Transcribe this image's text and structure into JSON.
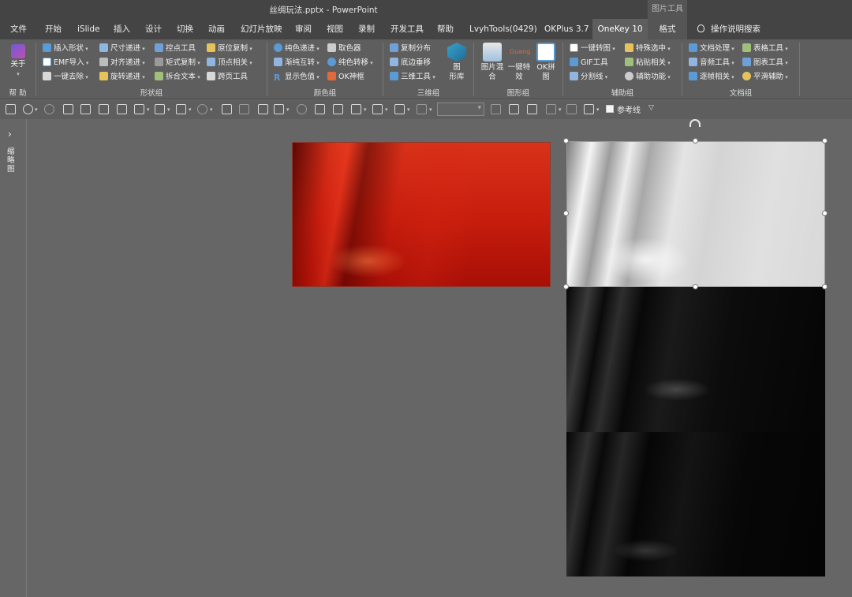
{
  "window": {
    "title": "丝绸玩法.pptx  -  PowerPoint",
    "context_tab_group": "图片工具"
  },
  "menu": {
    "tabs": [
      "文件",
      "开始",
      "iSlide",
      "插入",
      "设计",
      "切换",
      "动画",
      "幻灯片放映",
      "审阅",
      "视图",
      "录制",
      "开发工具",
      "帮助",
      "LvyhTools(0429)",
      "OKPlus 3.7",
      "OneKey 10",
      "格式"
    ],
    "active_tab": "OneKey 10",
    "tell_me": "操作说明搜索"
  },
  "ribbon": {
    "help_group": {
      "button": "关于",
      "label": "帮 助"
    },
    "shape_group": {
      "label": "形状组",
      "items": [
        "插入形状",
        "尺寸递进",
        "控点工具",
        "原位复制",
        "EMF导入",
        "对齐递进",
        "矩式复制",
        "顶点相关",
        "一键去除",
        "旋转递进",
        "拆合文本",
        "跨页工具"
      ]
    },
    "color_group": {
      "label": "颜色组",
      "items": [
        "纯色递进",
        "取色器",
        "渐纯互转",
        "纯色转移",
        "显示色值",
        "OK神框"
      ]
    },
    "three_d_group": {
      "label": "三维组",
      "items": [
        "复制分布",
        "底边垂移",
        "三维工具"
      ],
      "big_button": "图\n形库"
    },
    "graphic_group": {
      "label": "图形组",
      "big_buttons": [
        "图片混\n合",
        "一键特\n效",
        "OK拼\n图"
      ],
      "effect_logo_text": "Guang"
    },
    "assist_group": {
      "label": "辅助组",
      "items": [
        "一键转图",
        "特殊选中",
        "GIF工具",
        "粘贴相关",
        "分割线",
        "辅助功能"
      ]
    },
    "doc_group": {
      "label": "文档组",
      "items": [
        "文档处理",
        "表格工具",
        "音频工具",
        "图表工具",
        "逐帧相关",
        "平滑辅助"
      ]
    }
  },
  "quick_toolbar": {
    "guide_checkbox_label": "参考线"
  },
  "thumbnail_pane": {
    "label": "缩略图"
  },
  "canvas": {
    "pictures": [
      "red-silk",
      "white-silk",
      "black-silk-top",
      "black-silk-bottom"
    ],
    "selected": "white-silk"
  }
}
